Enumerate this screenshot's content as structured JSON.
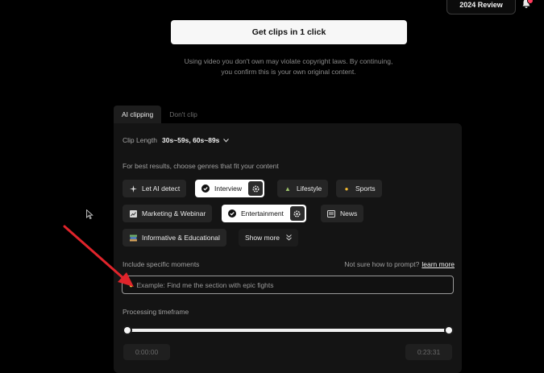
{
  "header": {
    "review_button": "2024 Review",
    "bell_icon": "bell-icon"
  },
  "cta": {
    "get_clips_label": "Get clips in 1 click",
    "notice_line1": "Using video you don't own may violate copyright laws. By continuing,",
    "notice_line2": "you confirm this is your own original content."
  },
  "tabs": [
    {
      "label": "AI clipping",
      "active": true
    },
    {
      "label": "Don't clip",
      "active": false
    }
  ],
  "clip_length": {
    "label": "Clip Length",
    "value": "30s~59s, 60s~89s"
  },
  "genres": {
    "hint": "For best results, choose genres that fit your content",
    "items": [
      {
        "label": "Let AI detect",
        "selected": false
      },
      {
        "label": "Interview",
        "selected": true
      },
      {
        "label": "Lifestyle",
        "selected": false
      },
      {
        "label": "Sports",
        "selected": false
      },
      {
        "label": "Marketing & Webinar",
        "selected": false
      },
      {
        "label": "Entertainment",
        "selected": true
      },
      {
        "label": "News",
        "selected": false
      },
      {
        "label": "Informative & Educational",
        "selected": false
      }
    ],
    "show_more": "Show more"
  },
  "moments": {
    "label": "Include specific moments",
    "help_text": "Not sure how to prompt?",
    "help_link": "learn more",
    "placeholder": "Example: Find me the section with epic fights"
  },
  "timeframe": {
    "label": "Processing timeframe",
    "start": "0:00:00",
    "end": "0:23:31"
  },
  "colors": {
    "background": "#000000",
    "panel": "#141414",
    "chip": "#252525",
    "annotation_arrow": "#e0242b"
  }
}
